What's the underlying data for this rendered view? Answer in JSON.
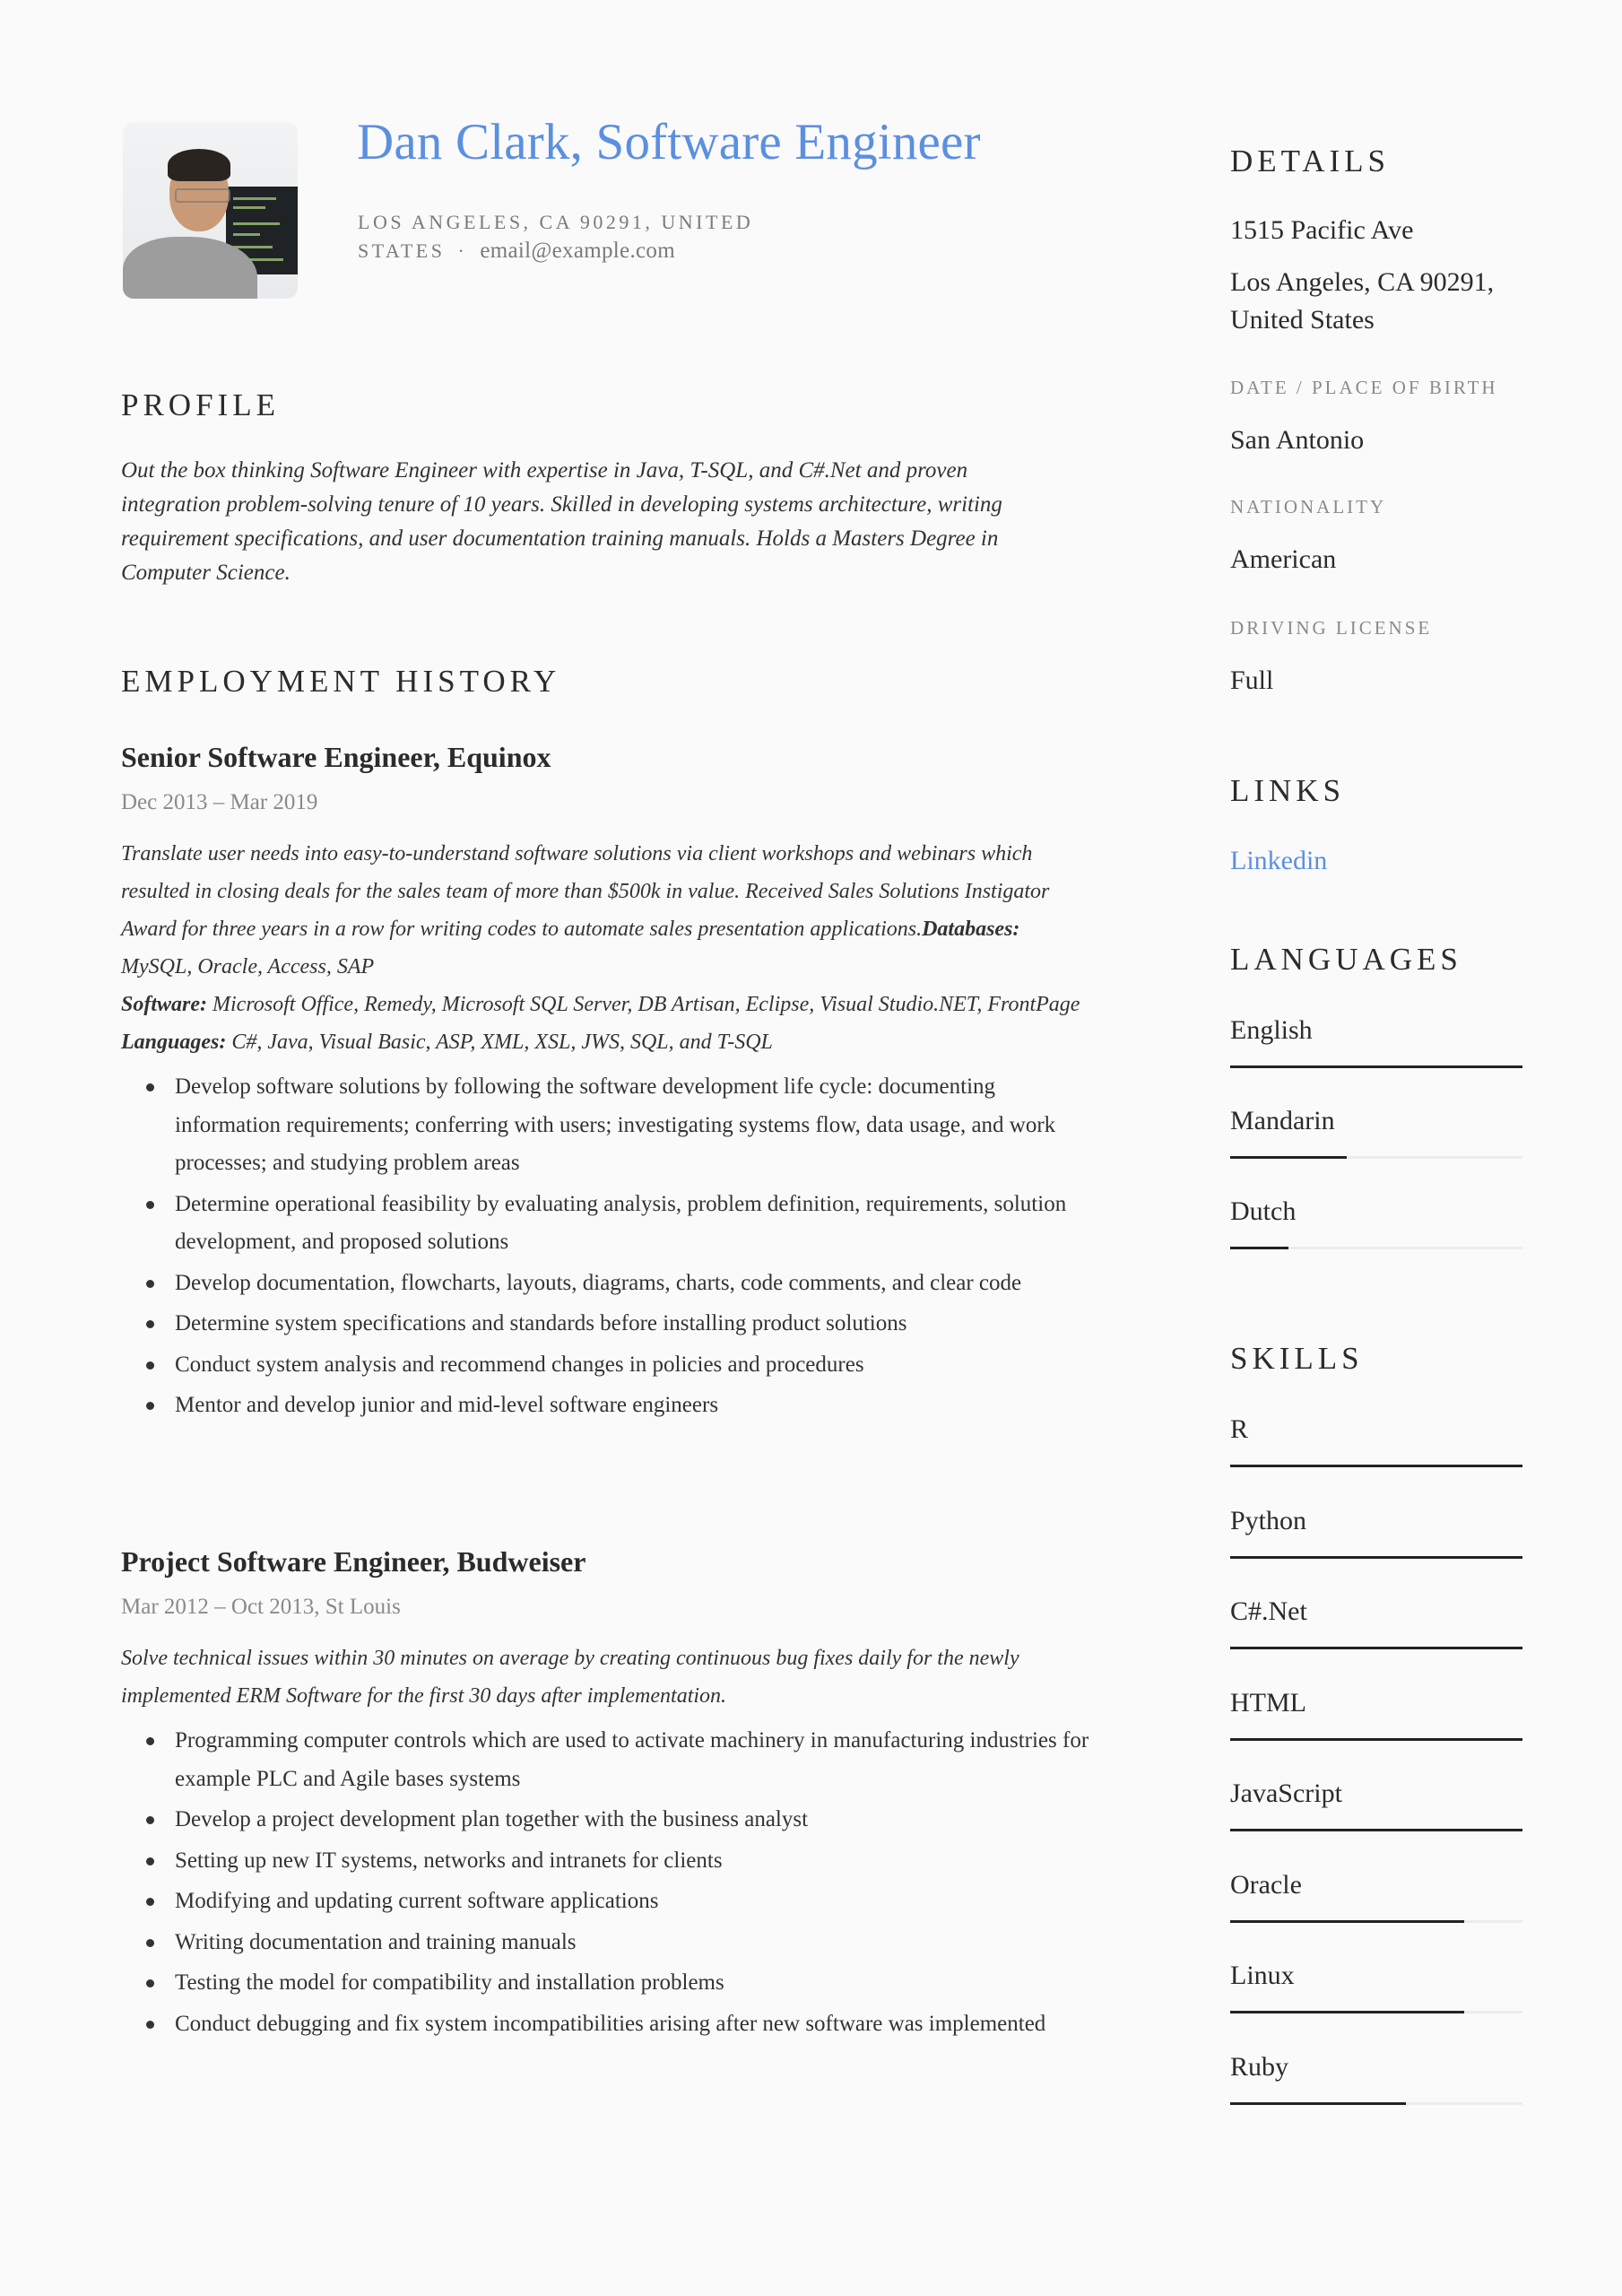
{
  "header": {
    "name_title": "Dan Clark, Software Engineer",
    "address_line1": "LOS ANGELES, CA 90291, UNITED",
    "address_line2": "STATES",
    "separator": "·",
    "email": "email@example.com",
    "photo_alt": "Profile photo of Dan Clark"
  },
  "profile": {
    "title": "PROFILE",
    "text": "Out the box thinking Software Engineer with expertise in Java, T-SQL, and C#.Net and proven integration problem-solving tenure of 10 years. Skilled in developing systems architecture, writing requirement specifications, and user documentation training manuals. Holds a Masters Degree in Computer Science."
  },
  "employment": {
    "title": "EMPLOYMENT HISTORY",
    "jobs": [
      {
        "title": "Senior Software Engineer, Equinox",
        "dates": "Dec 2013 – Mar 2019",
        "description": "Translate user needs into easy-to-understand software solutions via client workshops and webinars which resulted in closing deals for the sales team of more than $500k in value. Received Sales Solutions Instigator Award for three years in a row for writing codes to automate sales presentation applications.",
        "databases_label": "Databases:",
        "databases": "MySQL, Oracle, Access, SAP",
        "software_label": "Software:",
        "software": "Microsoft Office, Remedy, Microsoft SQL Server, DB Artisan, Eclipse, Visual Studio.NET, FrontPage",
        "languages_label": "Languages:",
        "languages": "C#, Java, Visual Basic, ASP, XML, XSL, JWS, SQL, and T-SQL",
        "bullets": [
          "Develop software solutions by following the software development life cycle: documenting information requirements; conferring with users; investigating systems flow, data usage, and work processes; and studying problem areas",
          "Determine operational feasibility by evaluating analysis, problem definition, requirements, solution development, and proposed solutions",
          "Develop documentation, flowcharts, layouts, diagrams, charts, code comments, and clear code",
          "Determine system specifications and standards before installing product solutions",
          "Conduct system analysis and recommend changes in policies and procedures",
          "Mentor and develop junior and mid-level software engineers"
        ]
      },
      {
        "title": "Project Software Engineer, Budweiser",
        "dates": "Mar 2012 – Oct 2013, St Louis",
        "description": "Solve technical issues within 30 minutes on average by creating continuous bug fixes daily for the newly implemented ERM Software for the first 30 days after implementation.",
        "bullets": [
          "Programming computer controls which are used to activate machinery in manufacturing industries for example PLC and Agile bases systems",
          "Develop a project development plan together with the business analyst",
          "Setting up new IT systems, networks and intranets for clients",
          "Modifying and updating current software applications",
          "Writing documentation and training manuals",
          "Testing the model for compatibility and installation problems",
          "Conduct debugging and fix system incompatibilities arising after new software was implemented"
        ]
      }
    ]
  },
  "details": {
    "title": "DETAILS",
    "address_street": "1515 Pacific Ave",
    "address_city": "Los Angeles, CA 90291, United States",
    "birth_label": "DATE / PLACE OF BIRTH",
    "birth_value": "San Antonio",
    "nationality_label": "NATIONALITY",
    "nationality_value": "American",
    "license_label": "DRIVING LICENSE",
    "license_value": "Full"
  },
  "links": {
    "title": "LINKS",
    "items": [
      {
        "label": "Linkedin"
      }
    ]
  },
  "languages": {
    "title": "LANGUAGES",
    "items": [
      {
        "name": "English",
        "level": 1.0
      },
      {
        "name": "Mandarin",
        "level": 0.4
      },
      {
        "name": "Dutch",
        "level": 0.2
      }
    ]
  },
  "skills": {
    "title": "SKILLS",
    "items": [
      {
        "name": "R",
        "level": 1.0
      },
      {
        "name": "Python",
        "level": 1.0
      },
      {
        "name": "C#.Net",
        "level": 1.0
      },
      {
        "name": "HTML",
        "level": 1.0
      },
      {
        "name": "JavaScript",
        "level": 1.0
      },
      {
        "name": "Oracle",
        "level": 0.8
      },
      {
        "name": "Linux",
        "level": 0.8
      },
      {
        "name": "Ruby",
        "level": 0.6
      }
    ]
  },
  "colors": {
    "accent": "#5b8fe0",
    "text": "#2b2b2b",
    "muted": "#8a8a8a",
    "background": "#fafafa"
  }
}
